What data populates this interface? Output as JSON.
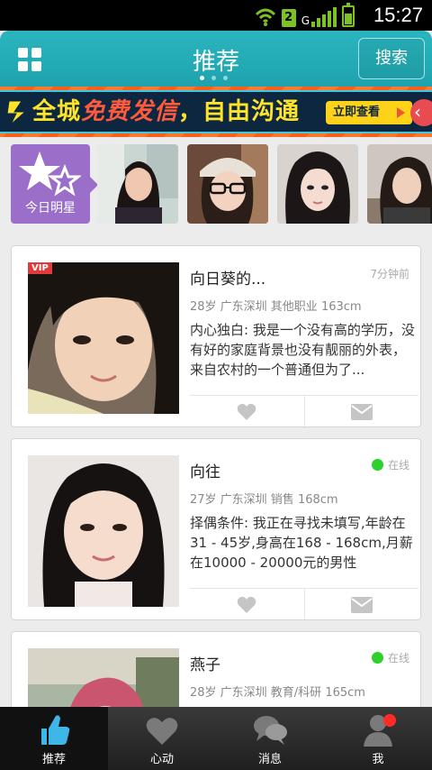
{
  "status_bar": {
    "sim_slot": "2",
    "network_type": "G",
    "time": "15:27",
    "icons": [
      "wifi-icon",
      "sim-icon",
      "signal-icon",
      "battery-icon"
    ]
  },
  "header": {
    "title": "推荐",
    "search_label": "搜索",
    "page_count": 3,
    "active_page": 1
  },
  "banner": {
    "text_prefix": "全城",
    "text_highlight": "免费发信",
    "text_suffix": "，自由沟通",
    "cta": "立即查看"
  },
  "stars": {
    "label": "今日明星",
    "avatar_count": 4
  },
  "cards": [
    {
      "name": "向日葵的...",
      "meta": "28岁  广东深圳 其他职业 163cm",
      "status": "7分钟前",
      "desc": "内心独白: 我是一个没有高的学历，没有好的家庭背景也没有靓丽的外表，来自农村的一个普通但为了...",
      "vip": "VIP"
    },
    {
      "name": "向往",
      "meta": "27岁  广东深圳 销售 168cm",
      "status": "在线",
      "desc": "择偶条件: 我正在寻找未填写,年龄在31 - 45岁,身高在168 - 168cm,月薪在10000  -  20000元的男性"
    },
    {
      "name": "燕子",
      "meta": "28岁  广东深圳 教育/科研 165cm",
      "status": "在线"
    }
  ],
  "bottom_nav": {
    "items": [
      {
        "label": "推荐",
        "icon": "thumbs-up-icon",
        "active": true
      },
      {
        "label": "心动",
        "icon": "heart-icon"
      },
      {
        "label": "消息",
        "icon": "chat-bubbles-icon"
      },
      {
        "label": "我",
        "icon": "person-icon",
        "badge": true
      }
    ]
  },
  "colors": {
    "header": "#22abb6",
    "online": "#2ed12a",
    "star_tile": "#9b6fc9",
    "nav_bg": "#2a2a2a"
  }
}
